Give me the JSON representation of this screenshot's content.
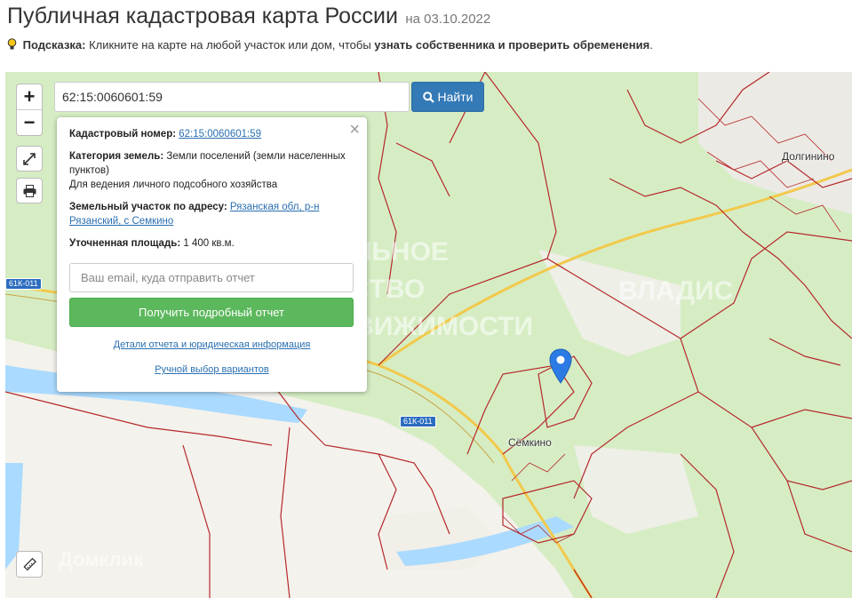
{
  "header": {
    "title": "Публичная кадастровая карта России",
    "date_label": "на 03.10.2022"
  },
  "hint": {
    "label": "Подсказка:",
    "text_before": "Кликните на карте на любой участок или дом, чтобы",
    "text_bold": "узнать собственника и проверить обременения",
    "text_after": "."
  },
  "map_controls": {
    "zoom_in": "+",
    "zoom_out": "−"
  },
  "search": {
    "value": "62:15:0060601:59",
    "button_label": "Найти"
  },
  "popup": {
    "close": "×",
    "cadastral_label": "Кадастровый номер:",
    "cadastral_value": "62:15:0060601:59",
    "category_label": "Категория земель:",
    "category_value": "Земли поселений (земли населенных пунктов)",
    "usage": "Для ведения личного подсобного хозяйства",
    "address_label": "Земельный участок по адресу:",
    "address_value": "Рязанская обл, р-н Рязанский, с Семкино",
    "area_label": "Уточненная площадь:",
    "area_value": "1 400 кв.м.",
    "email_placeholder": "Ваш email, куда отправить отчет",
    "report_button": "Получить подробный отчет",
    "details_link": "Детали отчета и юридическая информация",
    "manual_link": "Ручной выбор вариантов"
  },
  "map_labels": {
    "village_1": "Долгинино",
    "village_2": "Сёмкино",
    "road_1": "61К-011",
    "road_2": "61К-011"
  },
  "watermarks": {
    "wm_1": "ЦЕНТРАЛЬНОЕ",
    "wm_2": "АГЕНТСТВО",
    "wm_3": "НЕДВИЖИМОСТИ",
    "wm_4": "ВЛАДИС",
    "wm_5": "Домклик"
  },
  "colors": {
    "accent_blue": "#337ab7",
    "report_green": "#5cb85c",
    "parcel_border": "#b5292c",
    "forest": "#d6edc4",
    "water": "#aadaff"
  }
}
